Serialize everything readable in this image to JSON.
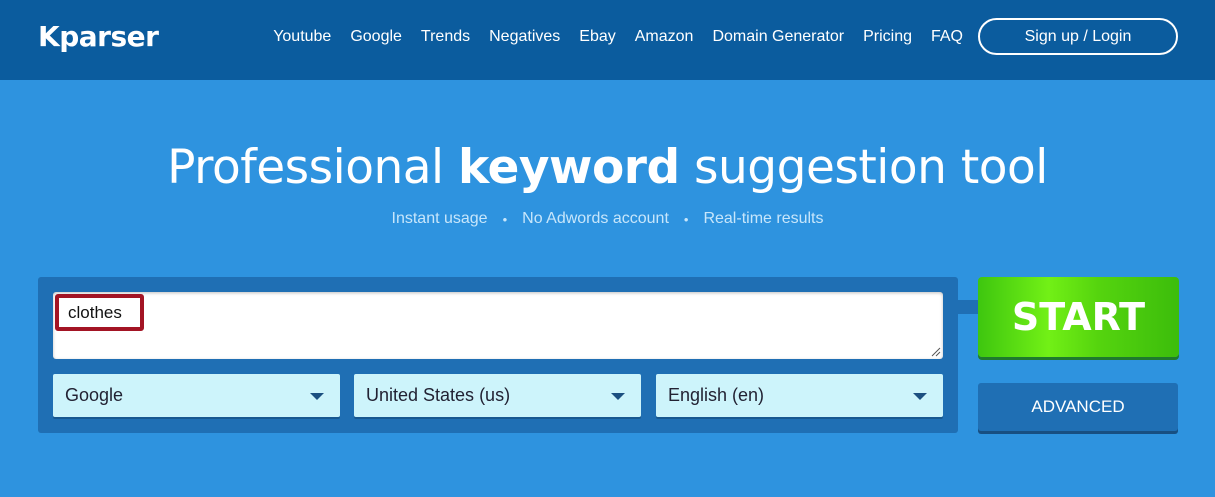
{
  "header": {
    "logo": "Kparser",
    "nav": [
      "Youtube",
      "Google",
      "Trends",
      "Negatives",
      "Ebay",
      "Amazon",
      "Domain Generator",
      "Pricing",
      "FAQ"
    ],
    "login_label": "Sign up / Login"
  },
  "hero": {
    "title_pre": "Professional ",
    "title_bold": "keyword",
    "title_post": " suggestion tool",
    "features": [
      "Instant usage",
      "No Adwords account",
      "Real-time results"
    ],
    "separator": "•"
  },
  "form": {
    "query_value": "clothes",
    "source_select": "Google",
    "country_select": "United States (us)",
    "language_select": "English (en)",
    "start_label": "START",
    "advanced_label": "ADVANCED"
  },
  "colors": {
    "header_bg": "#0b5c9e",
    "page_bg": "#2e93df",
    "panel_bg": "#1f6fb4",
    "start_green": "#72f016",
    "select_bg": "#cdf4fb",
    "highlight_border": "#a31424"
  }
}
